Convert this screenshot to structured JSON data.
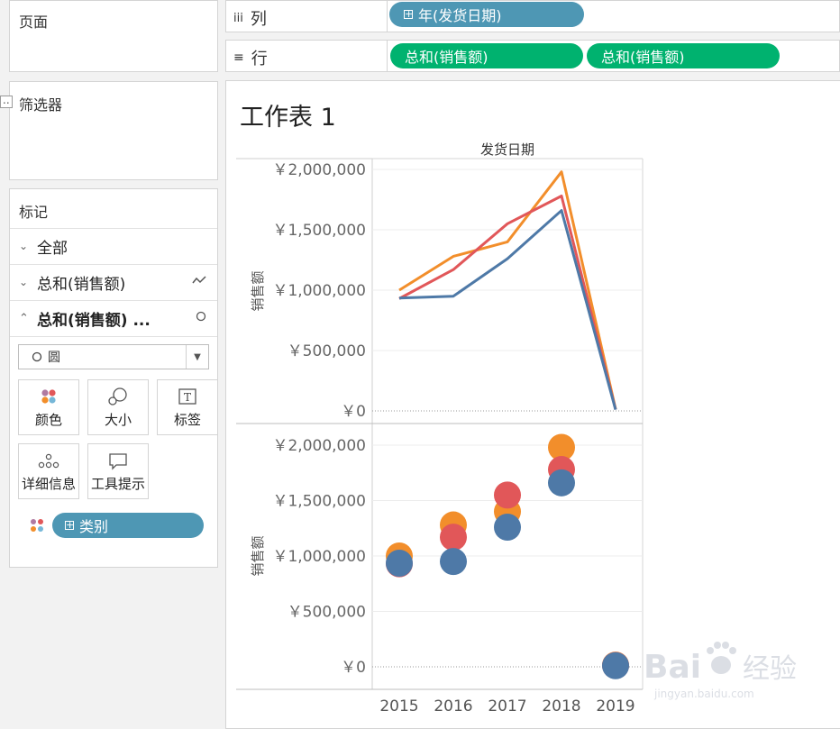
{
  "left_panel": {
    "pages": {
      "title": "页面"
    },
    "filters": {
      "title": "筛选器",
      "fragment": ".."
    },
    "marks": {
      "title": "标记",
      "rows": [
        {
          "label": "全部",
          "expanded": false
        },
        {
          "label": "总和(销售额)",
          "expanded": false,
          "icon": "line-mark-icon"
        },
        {
          "label": "总和(销售额) ...",
          "expanded": true,
          "icon": "circle-mark-icon"
        }
      ],
      "mark_type": "圆",
      "cards": [
        "颜色",
        "大小",
        "标签",
        "详细信息",
        "工具提示"
      ],
      "color_pill": "类别"
    }
  },
  "shelves": {
    "columns": {
      "label": "列",
      "pills": [
        "年(发货日期)"
      ]
    },
    "rows": {
      "label": "行",
      "pills": [
        "总和(销售额)",
        "总和(销售额)"
      ]
    }
  },
  "sheet": {
    "title": "工作表 1"
  },
  "chart_data": {
    "type": "line",
    "header": "发货日期",
    "categories": [
      "2015",
      "2016",
      "2017",
      "2018",
      "2019"
    ],
    "ylabel": "销售额",
    "ylim": [
      0,
      2000000
    ],
    "yticks": [
      "￥2,000,000",
      "￥1,500,000",
      "￥1,000,000",
      "￥500,000",
      "￥0"
    ],
    "panes": [
      {
        "mark": "line",
        "ylabel": "销售额"
      },
      {
        "mark": "circle",
        "ylabel": "销售额"
      }
    ],
    "series": [
      {
        "color": "#f28e2b",
        "values": [
          1000000,
          1280000,
          1400000,
          1980000,
          15000
        ]
      },
      {
        "color": "#e15759",
        "values": [
          930000,
          1170000,
          1550000,
          1780000,
          12000
        ]
      },
      {
        "color": "#4e79a7",
        "values": [
          935000,
          950000,
          1260000,
          1660000,
          10000
        ]
      }
    ]
  },
  "watermark": {
    "brand": "Bai",
    "cn": "经验",
    "url": "jingyan.baidu.com"
  }
}
